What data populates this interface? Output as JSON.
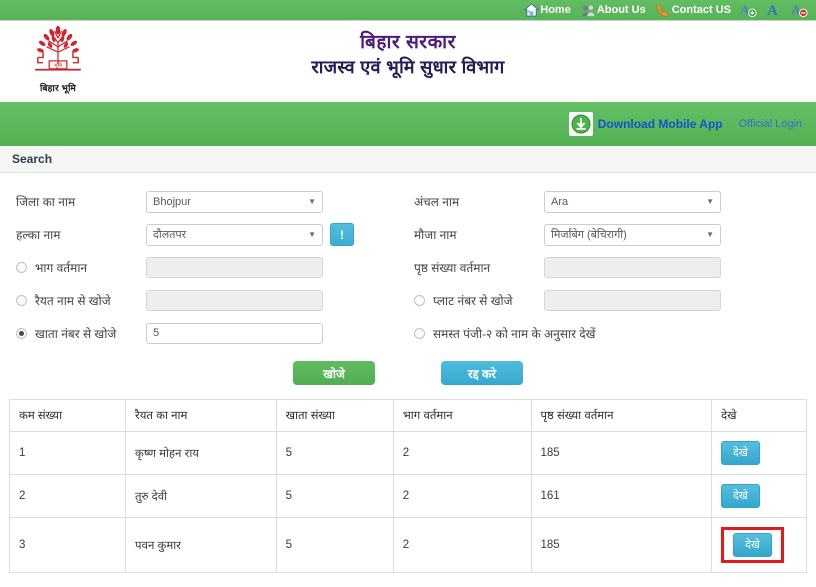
{
  "topnav": {
    "items": [
      {
        "label": "Home",
        "icon": "home-icon"
      },
      {
        "label": "About Us",
        "icon": "people-icon"
      },
      {
        "label": "Contact US",
        "icon": "phone-icon"
      }
    ],
    "font_controls": [
      {
        "name": "increase-font",
        "glyph": "A",
        "badge": "+",
        "badge_color": "#2fa62f"
      },
      {
        "name": "normal-font",
        "glyph": "A",
        "badge": "",
        "badge_color": ""
      },
      {
        "name": "decrease-font",
        "glyph": "A",
        "badge": "−",
        "badge_color": "#d03a2a"
      }
    ]
  },
  "header": {
    "logo_caption": "बिहार भूमि",
    "title_main": "बिहार सरकार",
    "title_sub": "राजस्व एवं भूमि सुधार विभाग",
    "title_main_color": "#4b1c79",
    "title_sub_color": "#1f1f55",
    "logo_color": "#d0252e"
  },
  "appband": {
    "download_label": "Download Mobile App",
    "download_icon": "download-arrow-icon",
    "official_login": "Official Login",
    "band_color": "#5cb85c",
    "link_color": "#1155cc"
  },
  "search_panel": {
    "title": "Search",
    "left": {
      "district_label": "जिला का नाम",
      "district_value": "Bhojpur",
      "halka_label": "हल्का नाम",
      "halka_value": "दौलतपर",
      "info_button": "!",
      "bhag_label": "भाग वर्तमान",
      "bhag_value": "",
      "raiyat_label": "रैयत नाम से खोजे",
      "raiyat_value": "",
      "khata_label": "खाता नंबर से खोजे",
      "khata_value": "5"
    },
    "right": {
      "anchal_label": "अंचल नाम",
      "anchal_value": "Ara",
      "mauja_label": "मौजा नाम",
      "mauja_value": "मिर्जांबेग (बेचिरागी)",
      "prsth_label": "पृष्ठ संख्या वर्तमान",
      "prsth_value": "",
      "plot_label": "प्लाट नंबर से खोजे",
      "plot_value": "",
      "panji_label": "समस्त पंजी-२ को नाम के अनुसार देखें"
    },
    "buttons": {
      "search": "खोजे",
      "cancel": "रद्द करे"
    }
  },
  "results": {
    "columns": [
      "कम संख्या",
      "रैयत का नाम",
      "खाता संख्या",
      "भाग वर्तमान",
      "पृष्ठ संख्या वर्तमान",
      "देखे"
    ],
    "rows": [
      {
        "sl": "1",
        "name": "कृष्ण मोहन राय",
        "khata": "5",
        "bhag": "2",
        "prsth": "185",
        "view": "देखे",
        "highlighted": false
      },
      {
        "sl": "2",
        "name": "तुरु देवी",
        "khata": "5",
        "bhag": "2",
        "prsth": "161",
        "view": "देखे",
        "highlighted": false
      },
      {
        "sl": "3",
        "name": "पवन कुमार",
        "khata": "5",
        "bhag": "2",
        "prsth": "185",
        "view": "देखे",
        "highlighted": true
      }
    ],
    "highlight_color": "#e01b1b"
  }
}
